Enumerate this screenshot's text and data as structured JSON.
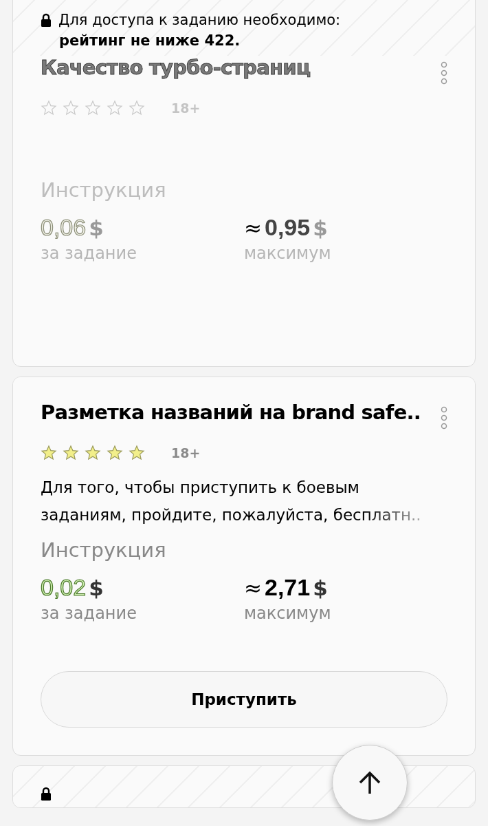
{
  "cards": [
    {
      "locked": true,
      "lock_notice": "Для доступа к заданию необходимо:",
      "lock_requirement": "рейтинг не ниже 422.",
      "title": "Качество турбо-страниц",
      "stars": 0,
      "age": "18+",
      "instruction": "Инструкция",
      "price": "0,06",
      "price_currency": "$",
      "price_label": "за задание",
      "max_prefix": "≈",
      "max": "0,95",
      "max_currency": "$",
      "max_label": "максимум"
    },
    {
      "locked": false,
      "title": "Разметка названий на brand safe..",
      "stars": 5,
      "age": "18+",
      "description": "Для того, чтобы приступить к боевым заданиям, пройдите, пожалуйста, бесплатн..",
      "instruction": "Инструкция",
      "price": "0,02",
      "price_currency": "$",
      "price_label": "за задание",
      "max_prefix": "≈",
      "max": "2,71",
      "max_currency": "$",
      "max_label": "максимум",
      "button": "Приступить"
    },
    {
      "locked": true
    }
  ]
}
